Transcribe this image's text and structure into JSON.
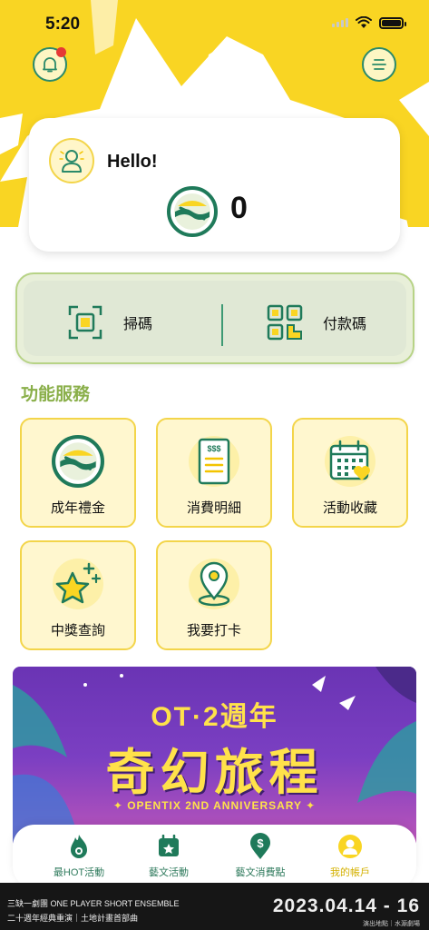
{
  "status_bar": {
    "time": "5:20"
  },
  "header": {
    "notification_dot": true
  },
  "account": {
    "greeting": "Hello!",
    "points": "0"
  },
  "quick_actions": {
    "scan_label": "掃碼",
    "pay_label": "付款碼"
  },
  "services": {
    "title": "功能服務",
    "items": [
      {
        "label": "成年禮金",
        "icon": "coin-logo-icon"
      },
      {
        "label": "消費明細",
        "icon": "receipt-icon"
      },
      {
        "label": "活動收藏",
        "icon": "calendar-heart-icon"
      },
      {
        "label": "中獎查詢",
        "icon": "star-icon"
      },
      {
        "label": "我要打卡",
        "icon": "location-pin-icon"
      }
    ]
  },
  "banner": {
    "title_line": "OT·2週年",
    "headline": "奇幻旅程",
    "subtitle": "✦ OPENTIX 2ND ANNIVERSARY ✦"
  },
  "tabbar": {
    "items": [
      {
        "label": "最HOT活動",
        "icon": "flame-icon"
      },
      {
        "label": "藝文活動",
        "icon": "calendar-star-icon"
      },
      {
        "label": "藝文消費點",
        "icon": "dollar-pin-icon"
      },
      {
        "label": "我的帳戶",
        "icon": "user-icon",
        "active": true
      }
    ]
  },
  "promo": {
    "line1": "三缺一劇團 ONE PLAYER SHORT ENSEMBLE",
    "line2": "二十週年經典重演｜土地計畫首部曲",
    "date": "2023.04.14 - 16",
    "venue": "演出地點｜水源劇場"
  },
  "colors": {
    "yellow": "#f9d523",
    "green": "#1f7a5a",
    "accent_green": "#8aaf4a"
  }
}
